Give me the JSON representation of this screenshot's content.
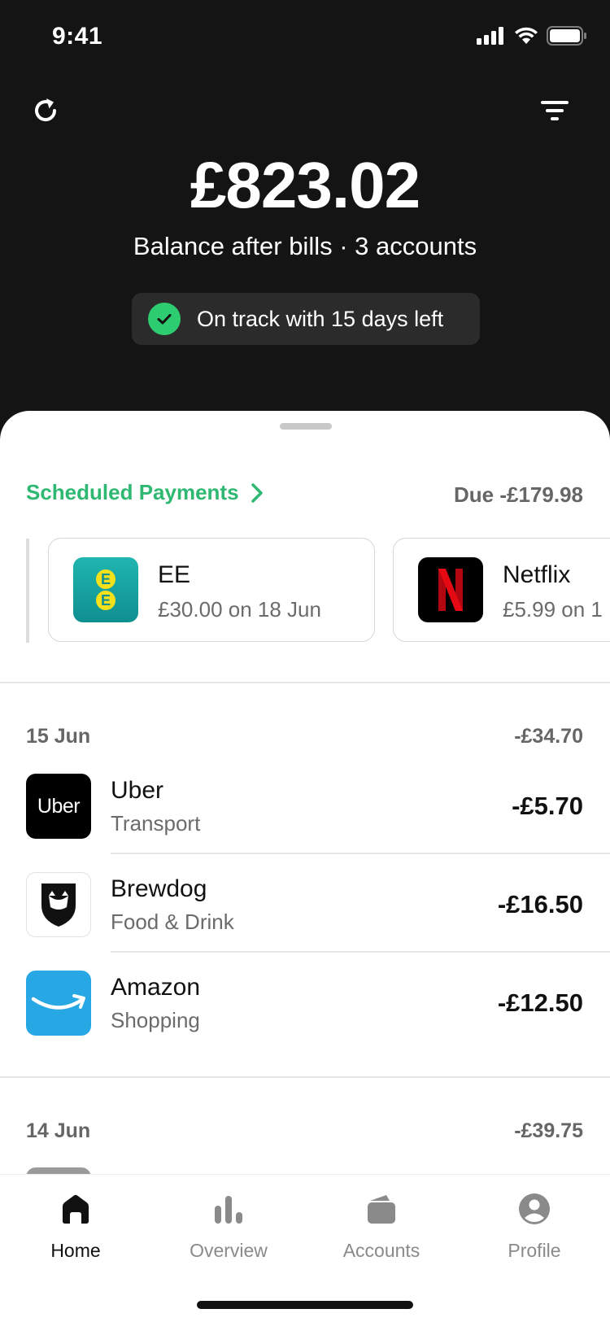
{
  "status_bar": {
    "time": "9:41"
  },
  "header": {
    "balance": "£823.02",
    "subtitle": "Balance after bills · 3 accounts",
    "status_pill": "On track with 15 days left"
  },
  "scheduled": {
    "title": "Scheduled Payments",
    "due": "Due -£179.98",
    "cards": [
      {
        "name": "EE",
        "detail": "£30.00 on 18 Jun",
        "logo_text": "E E"
      },
      {
        "name": "Netflix",
        "detail": "£5.99 on 1",
        "logo_text": "N"
      }
    ]
  },
  "days": [
    {
      "label": "15 Jun",
      "total": "-£34.70",
      "transactions": [
        {
          "name": "Uber",
          "category": "Transport",
          "amount": "-£5.70",
          "logo_text": "Uber"
        },
        {
          "name": "Brewdog",
          "category": "Food & Drink",
          "amount": "-£16.50"
        },
        {
          "name": "Amazon",
          "category": "Shopping",
          "amount": "-£12.50"
        }
      ]
    },
    {
      "label": "14 Jun",
      "total": "-£39.75",
      "transactions": []
    }
  ],
  "tabbar": {
    "items": [
      {
        "label": "Home",
        "icon": "home-icon",
        "active": true
      },
      {
        "label": "Overview",
        "icon": "bar-chart-icon",
        "active": false
      },
      {
        "label": "Accounts",
        "icon": "wallet-icon",
        "active": false
      },
      {
        "label": "Profile",
        "icon": "profile-icon",
        "active": false
      }
    ]
  },
  "colors": {
    "header_bg": "#141414",
    "accent_green": "#2eb872",
    "ee_teal": "#1ba6a6",
    "ee_yellow": "#f5e11b",
    "netflix_red": "#e50914",
    "amazon_blue": "#27a7e4"
  }
}
